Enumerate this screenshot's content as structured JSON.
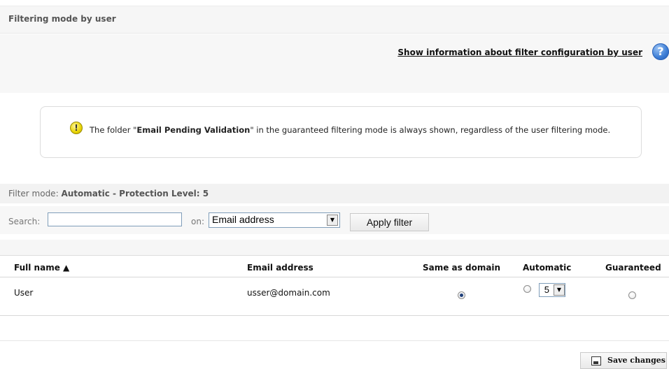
{
  "section": {
    "title": "Filtering mode by user"
  },
  "info": {
    "link_text": "Show information about filter configuration by user",
    "help_icon": "?"
  },
  "notice": {
    "icon_glyph": "!",
    "text_before": "The folder \"",
    "folder_name": "Email Pending Validation",
    "text_after": "\" in the guaranteed filtering mode is always shown, regardless of the user filtering mode."
  },
  "filter": {
    "mode_label": "Filter mode:",
    "mode_value": "Automatic - Protection Level: 5",
    "search_label": "Search:",
    "search_value": "",
    "on_label": "on:",
    "on_selected": "Email address",
    "apply_label": "Apply filter"
  },
  "table": {
    "headers": {
      "full_name": "Full name",
      "sort_indicator": "▲",
      "email": "Email address",
      "same_as_domain": "Same as domain",
      "automatic": "Automatic",
      "guaranteed": "Guaranteed"
    },
    "rows": [
      {
        "full_name": "User",
        "email": "usser@domain.com",
        "mode": "same_as_domain",
        "level": "5"
      }
    ]
  },
  "actions": {
    "save_label": "Save changes"
  },
  "colors": {
    "help_icon": "#3f7fd6",
    "warning_icon": "#e8d400",
    "input_border": "#7f9db9"
  }
}
